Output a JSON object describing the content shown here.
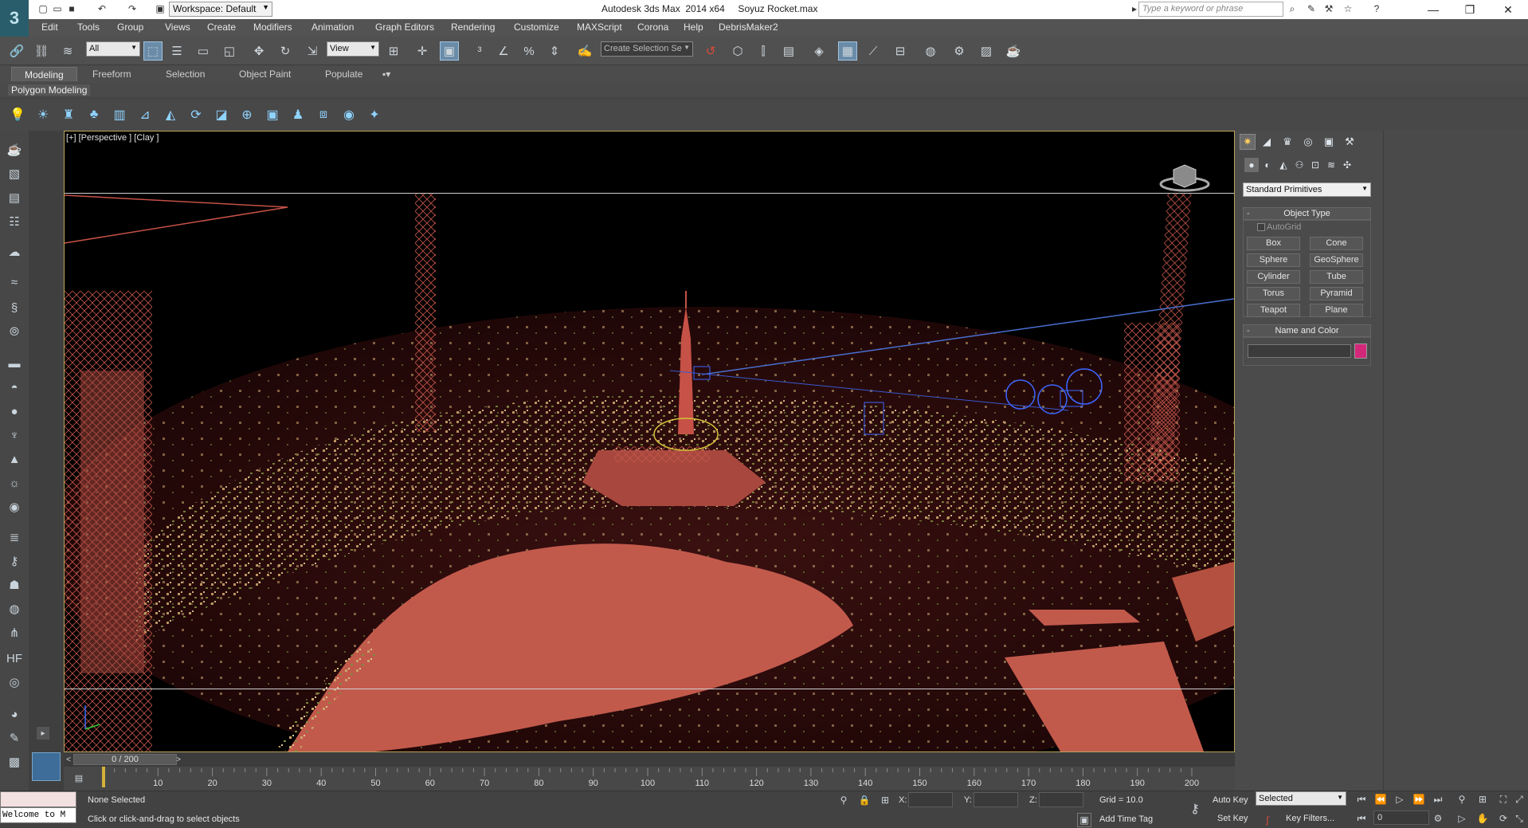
{
  "titlebar": {
    "title": "Autodesk 3ds Max  2014 x64     Soyuz Rocket.max",
    "workspace": "Workspace: Default",
    "search_placeholder": "Type a keyword or phrase"
  },
  "menu": [
    "Edit",
    "Tools",
    "Group",
    "Views",
    "Create",
    "Modifiers",
    "Animation",
    "Graph Editors",
    "Rendering",
    "Customize",
    "MAXScript",
    "Corona",
    "Help",
    "DebrisMaker2"
  ],
  "toolbar": {
    "selection_filter": "All",
    "ref_coord": "View",
    "named_selection": "Create Selection Se"
  },
  "ribbon": {
    "tabs": [
      "Modeling",
      "Freeform",
      "Selection",
      "Object Paint",
      "Populate"
    ],
    "panel_label": "Polygon Modeling"
  },
  "viewport": {
    "label": "[+] [Perspective ] [Clay ]"
  },
  "command_panel": {
    "category": "Standard Primitives",
    "object_type_title": "Object Type",
    "autogrid": "AutoGrid",
    "buttons": [
      "Box",
      "Cone",
      "Sphere",
      "GeoSphere",
      "Cylinder",
      "Tube",
      "Torus",
      "Pyramid",
      "Teapot",
      "Plane"
    ],
    "name_color_title": "Name and Color",
    "object_color": "#d3287a"
  },
  "timeline": {
    "slider_label": "0 / 200",
    "ticks": [
      10,
      20,
      30,
      40,
      50,
      60,
      70,
      80,
      90,
      100,
      110,
      120,
      130,
      140,
      150,
      160,
      170,
      180,
      190,
      200
    ]
  },
  "status": {
    "maxscript_text": "Welcome to M",
    "selection": "None Selected",
    "prompt": "Click or click-and-drag to select objects",
    "x_label": "X:",
    "y_label": "Y:",
    "z_label": "Z:",
    "grid": "Grid = 10.0",
    "add_time_tag": "Add Time Tag",
    "auto_key": "Auto Key",
    "set_key": "Set Key",
    "key_mode": "Selected",
    "key_filters": "Key Filters...",
    "current_frame": "0"
  }
}
